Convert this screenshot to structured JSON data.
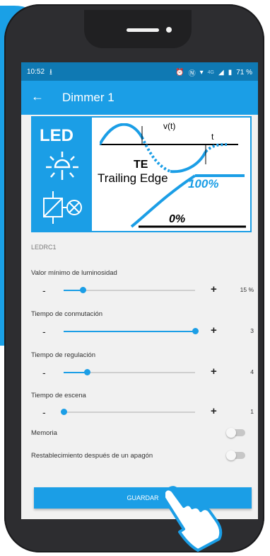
{
  "status_bar": {
    "time": "10:52",
    "battery": "71 %",
    "network": "4G"
  },
  "app_bar": {
    "title": "Dimmer 1"
  },
  "diagram": {
    "led_label": "LED",
    "vt_label": "v(t)",
    "t_label": "t",
    "te_label": "TE",
    "te_sub": "Trailing Edge",
    "pct_100": "100%",
    "pct_0": "0%"
  },
  "device_id": "LEDRC1",
  "settings": [
    {
      "label": "Valor mínimo de luminosidad",
      "value": "15 %",
      "level": 0.15
    },
    {
      "label": "Tiempo de conmutación",
      "value": "3",
      "level": 1.0
    },
    {
      "label": "Tiempo de regulación",
      "value": "4",
      "level": 0.18
    },
    {
      "label": "Tiempo de escena",
      "value": "1",
      "level": 0.0
    }
  ],
  "minus_label": "-",
  "plus_label": "+",
  "toggles": [
    {
      "label": "Memoria",
      "on": false
    },
    {
      "label": "Restablecimiento después de un apagón",
      "on": false
    }
  ],
  "save_button": "GUARDAR",
  "colors": {
    "accent": "#1b9ee6",
    "status_bar": "#0f79b3",
    "phone_frame": "#2d2d30"
  }
}
